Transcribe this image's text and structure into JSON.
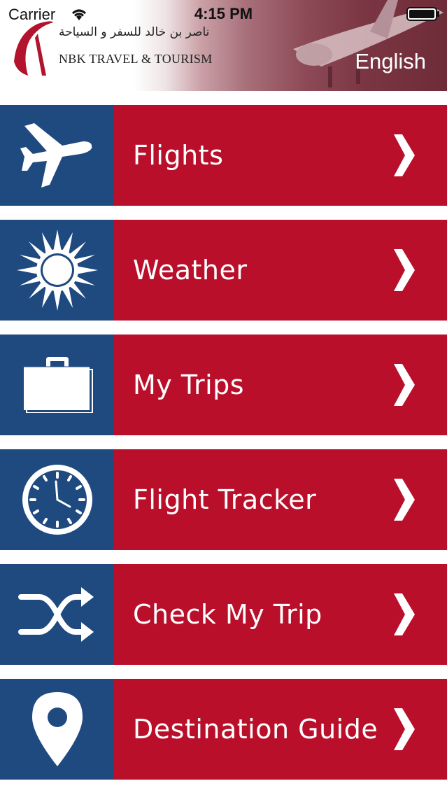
{
  "status_bar": {
    "carrier": "Carrier",
    "time": "4:15 PM"
  },
  "header": {
    "logo_arabic": "ناصر بن خالد للسفر و السياحة",
    "logo_text": "NBK TRAVEL & TOURISM",
    "language_button": "English"
  },
  "colors": {
    "icon_panel": "#1f4a80",
    "label_panel": "#b90f2b",
    "text": "#ffffff"
  },
  "menu": {
    "items": [
      {
        "label": "Flights",
        "icon": "airplane-icon"
      },
      {
        "label": "Weather",
        "icon": "sun-icon"
      },
      {
        "label": "My Trips",
        "icon": "briefcase-icon"
      },
      {
        "label": "Flight Tracker",
        "icon": "clock-icon"
      },
      {
        "label": "Check My Trip",
        "icon": "shuffle-icon"
      },
      {
        "label": "Destination Guide",
        "icon": "location-pin-icon"
      }
    ]
  }
}
